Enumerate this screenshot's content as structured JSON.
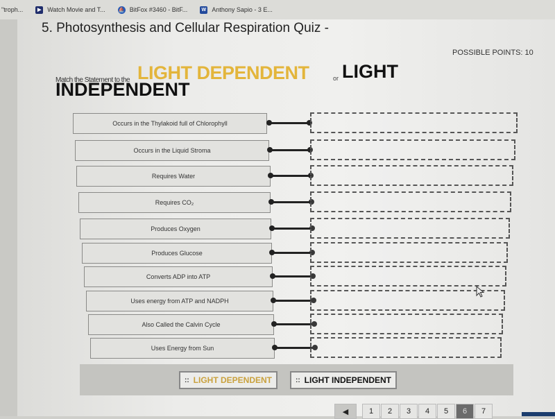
{
  "bookmarks": [
    {
      "label": "\"troph...",
      "icon": "bookmark-icon"
    },
    {
      "label": "Watch Movie and T...",
      "icon": "movie-icon"
    },
    {
      "label": "BitFox #3460 - BitF...",
      "icon": "bitfox-icon"
    },
    {
      "label": "Anthony Sapio - 3 E...",
      "icon": "word-icon"
    }
  ],
  "question": {
    "title": "5. Photosynthesis and Cellular Respiration Quiz -",
    "points_label": "POSSIBLE POINTS: 10",
    "prompt_small": "Match the Statement to the",
    "prompt_dependent": "LIGHT DEPENDENT",
    "prompt_or": "or",
    "prompt_light": "LIGHT",
    "prompt_independent": "INDEPENDENT"
  },
  "statements": [
    "Occurs in the Thylakoid full of Chlorophyll",
    "Occurs in the Liquid Stroma",
    "Requires Water",
    "Requires CO₂",
    "Produces Oxygen",
    "Produces Glucose",
    "Converts ADP into ATP",
    "Uses energy from ATP and NADPH",
    "Also Called the Calvin Cycle",
    "Uses Energy from Sun"
  ],
  "answer_options": [
    {
      "label": "LIGHT DEPENDENT",
      "color": "#c9a13d",
      "grip": "::"
    },
    {
      "label": "LIGHT INDEPENDENT",
      "color": "#111111",
      "grip": "::"
    }
  ],
  "pagination": {
    "prev": "◀",
    "pages": [
      "1",
      "2",
      "3",
      "4",
      "5",
      "6",
      "7"
    ],
    "current": "6"
  },
  "colors": {
    "dependent": "#e3b53b",
    "independent": "#111111"
  }
}
